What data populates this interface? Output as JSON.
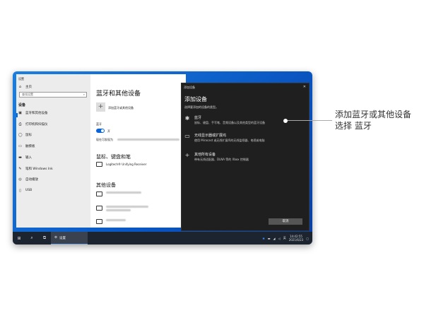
{
  "settings": {
    "title": "设置",
    "home": "主页",
    "search_placeholder": "查找设置",
    "section": "设备",
    "nav": [
      {
        "icon": "bluetooth-devices-icon",
        "glyph": "▣",
        "label": "蓝牙和其他设备"
      },
      {
        "icon": "printer-icon",
        "glyph": "⎙",
        "label": "打印机和扫描仪"
      },
      {
        "icon": "mouse-icon",
        "glyph": "◯",
        "label": "鼠标"
      },
      {
        "icon": "touchpad-icon",
        "glyph": "▭",
        "label": "触摸板"
      },
      {
        "icon": "keyboard-icon",
        "glyph": "▬",
        "label": "输入"
      },
      {
        "icon": "pen-icon",
        "glyph": "✎",
        "label": "笔和 Windows Ink"
      },
      {
        "icon": "autoplay-icon",
        "glyph": "◎",
        "label": "自动播放"
      },
      {
        "icon": "usb-icon",
        "glyph": "▯",
        "label": "USB"
      }
    ],
    "page_title": "蓝牙和其他设备",
    "add_device": "添加蓝牙或其他设备",
    "bt_label": "蓝牙",
    "bt_state": "开",
    "discoverable": "现在可发现为",
    "mice_heading": "鼠标、键盘和笔",
    "logitech": "Logitech® Unifying Receiver",
    "other_heading": "其他设备"
  },
  "dialog": {
    "titlebar": "添加设备",
    "title": "添加设备",
    "subtitle": "选择要添加的设备的类型。",
    "options": [
      {
        "icon": "bluetooth-icon",
        "glyph": "✱",
        "title": "蓝牙",
        "desc": "鼠标、键盘、手写笔、音频设备以及其他类型的蓝牙设备"
      },
      {
        "icon": "monitor-icon",
        "glyph": "▭",
        "title": "无线显示器或扩展坞",
        "desc": "使用 Miracast 或无线扩展坞的无线监视器、电视或电脑"
      },
      {
        "icon": "plus-icon",
        "glyph": "+",
        "title": "其他所有设备",
        "desc": "带有无线适配器、DLNA 等的 Xbox 控制器"
      }
    ],
    "cancel": "取消"
  },
  "taskbar": {
    "app": "设置",
    "ime": "英",
    "time": "14:42:55",
    "date": "2021/6/23"
  },
  "annotation": {
    "line1": "添加蓝牙或其他设备",
    "line2": "选择 蓝牙"
  }
}
